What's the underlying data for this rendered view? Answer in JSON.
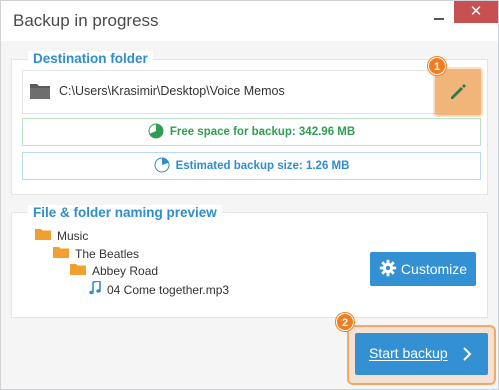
{
  "window": {
    "title": "Backup in progress",
    "close_glyph": "✕"
  },
  "destination": {
    "section_title": "Destination folder",
    "path": "C:\\Users\\Krasimir\\Desktop\\Voice Memos",
    "free_space_label": "Free space for backup: 342.96 MB",
    "estimated_size_label": "Estimated backup size: 1.26 MB",
    "free_space_fraction": 0.7,
    "estimated_fraction": 0.15
  },
  "naming_preview": {
    "section_title": "File & folder naming preview",
    "tree": [
      {
        "label": "Music",
        "kind": "folder"
      },
      {
        "label": "The Beatles",
        "kind": "folder"
      },
      {
        "label": "Abbey Road",
        "kind": "folder"
      },
      {
        "label": "04 Come together.mp3",
        "kind": "music-file"
      }
    ],
    "customize_label": "Customize"
  },
  "actions": {
    "start_label": "Start backup"
  },
  "tutorial_badges": [
    "1",
    "2"
  ],
  "colors": {
    "accent_blue": "#2f8dcc",
    "button_blue": "#3391d3",
    "green": "#2f9e51",
    "highlight_orange": "#ef7d22",
    "edit_bg": "#f1b57a",
    "close_red": "#c75050"
  }
}
